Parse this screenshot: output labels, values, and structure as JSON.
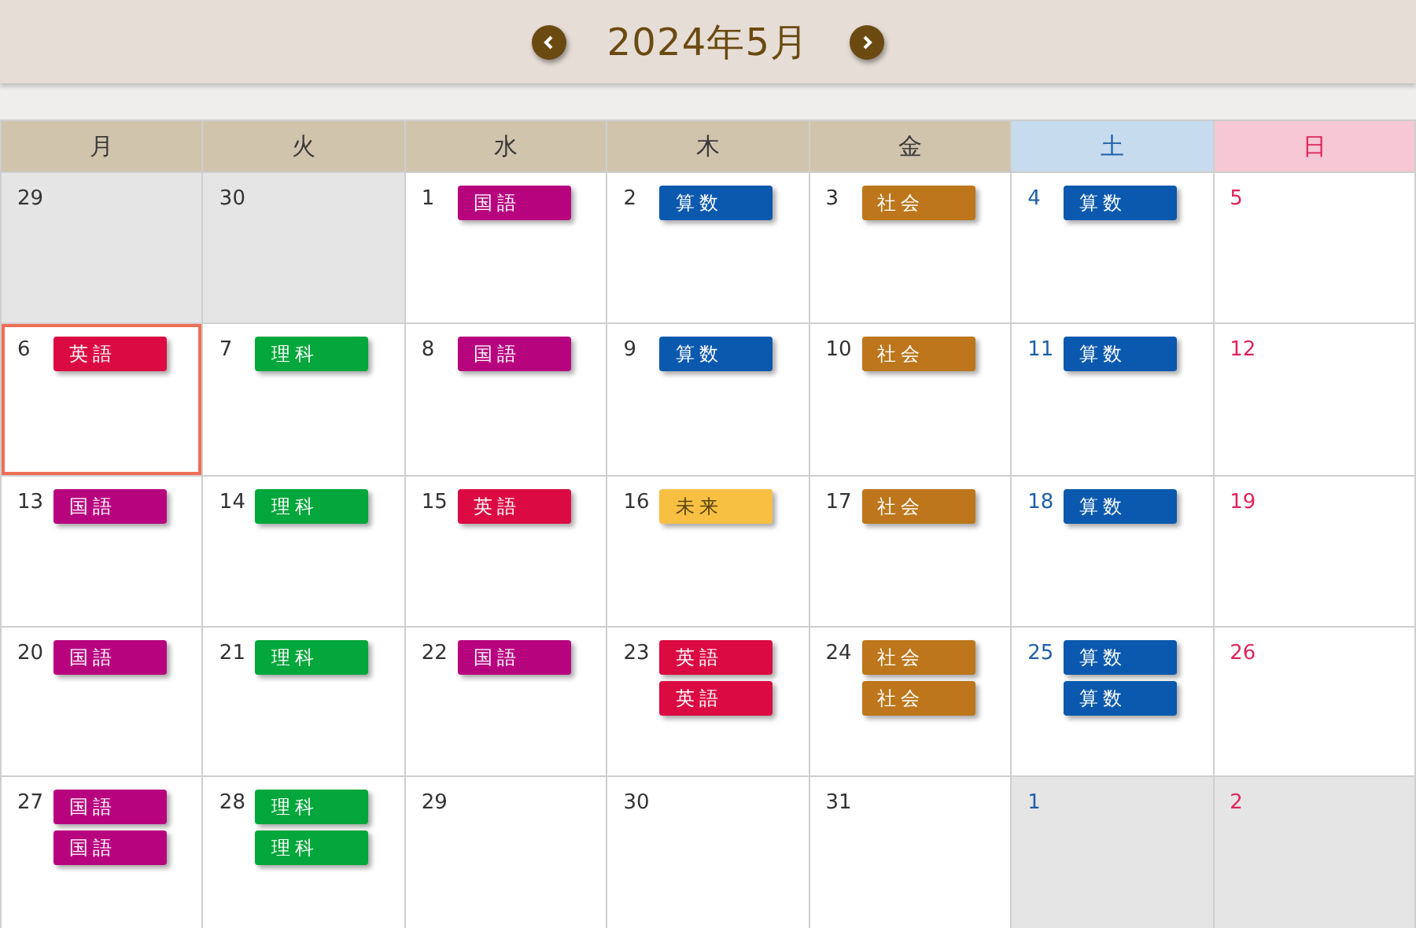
{
  "header": {
    "title": "2024年5月"
  },
  "weekdays": [
    {
      "label": "月",
      "kind": "weekday"
    },
    {
      "label": "火",
      "kind": "weekday"
    },
    {
      "label": "水",
      "kind": "weekday"
    },
    {
      "label": "木",
      "kind": "weekday"
    },
    {
      "label": "金",
      "kind": "weekday"
    },
    {
      "label": "土",
      "kind": "saturday"
    },
    {
      "label": "日",
      "kind": "sunday"
    }
  ],
  "days": [
    {
      "date": "29",
      "outside": true,
      "selected": false
    },
    {
      "date": "30",
      "outside": true,
      "selected": false
    },
    {
      "date": "1",
      "outside": false,
      "selected": false,
      "events": [
        {
          "label": "国語",
          "color": "#b8037f"
        }
      ]
    },
    {
      "date": "2",
      "outside": false,
      "selected": false,
      "events": [
        {
          "label": "算数",
          "color": "#0b59ae"
        }
      ]
    },
    {
      "date": "3",
      "outside": false,
      "selected": false,
      "events": [
        {
          "label": "社会",
          "color": "#bd761b"
        }
      ]
    },
    {
      "date": "4",
      "outside": false,
      "selected": false,
      "events": [
        {
          "label": "算数",
          "color": "#0b59ae"
        }
      ]
    },
    {
      "date": "5",
      "outside": false,
      "selected": false
    },
    {
      "date": "6",
      "outside": false,
      "selected": true,
      "events": [
        {
          "label": "英語",
          "color": "#dc0a42"
        }
      ]
    },
    {
      "date": "7",
      "outside": false,
      "selected": false,
      "events": [
        {
          "label": "理科",
          "color": "#03a73b"
        }
      ]
    },
    {
      "date": "8",
      "outside": false,
      "selected": false,
      "events": [
        {
          "label": "国語",
          "color": "#b8037f"
        }
      ]
    },
    {
      "date": "9",
      "outside": false,
      "selected": false,
      "events": [
        {
          "label": "算数",
          "color": "#0b59ae"
        }
      ]
    },
    {
      "date": "10",
      "outside": false,
      "selected": false,
      "events": [
        {
          "label": "社会",
          "color": "#bd761b"
        }
      ]
    },
    {
      "date": "11",
      "outside": false,
      "selected": false,
      "events": [
        {
          "label": "算数",
          "color": "#0b59ae"
        }
      ]
    },
    {
      "date": "12",
      "outside": false,
      "selected": false
    },
    {
      "date": "13",
      "outside": false,
      "selected": false,
      "events": [
        {
          "label": "国語",
          "color": "#b8037f"
        }
      ]
    },
    {
      "date": "14",
      "outside": false,
      "selected": false,
      "events": [
        {
          "label": "理科",
          "color": "#03a73b"
        }
      ]
    },
    {
      "date": "15",
      "outside": false,
      "selected": false,
      "events": [
        {
          "label": "英語",
          "color": "#dc0a42"
        }
      ]
    },
    {
      "date": "16",
      "outside": false,
      "selected": false,
      "events": [
        {
          "label": "未来",
          "color": "#f7c043"
        }
      ]
    },
    {
      "date": "17",
      "outside": false,
      "selected": false,
      "events": [
        {
          "label": "社会",
          "color": "#bd761b"
        }
      ]
    },
    {
      "date": "18",
      "outside": false,
      "selected": false,
      "events": [
        {
          "label": "算数",
          "color": "#0b59ae"
        }
      ]
    },
    {
      "date": "19",
      "outside": false,
      "selected": false
    },
    {
      "date": "20",
      "outside": false,
      "selected": false,
      "events": [
        {
          "label": "国語",
          "color": "#b8037f"
        }
      ]
    },
    {
      "date": "21",
      "outside": false,
      "selected": false,
      "events": [
        {
          "label": "理科",
          "color": "#03a73b"
        }
      ]
    },
    {
      "date": "22",
      "outside": false,
      "selected": false,
      "events": [
        {
          "label": "国語",
          "color": "#b8037f"
        }
      ]
    },
    {
      "date": "23",
      "outside": false,
      "selected": false,
      "events": [
        {
          "label": "英語",
          "color": "#dc0a42"
        },
        {
          "label": "英語",
          "color": "#dc0a42"
        }
      ]
    },
    {
      "date": "24",
      "outside": false,
      "selected": false,
      "events": [
        {
          "label": "社会",
          "color": "#bd761b"
        },
        {
          "label": "社会",
          "color": "#bd761b"
        }
      ]
    },
    {
      "date": "25",
      "outside": false,
      "selected": false,
      "events": [
        {
          "label": "算数",
          "color": "#0b59ae"
        },
        {
          "label": "算数",
          "color": "#0b59ae"
        }
      ]
    },
    {
      "date": "26",
      "outside": false,
      "selected": false
    },
    {
      "date": "27",
      "outside": false,
      "selected": false,
      "events": [
        {
          "label": "国語",
          "color": "#b8037f"
        },
        {
          "label": "国語",
          "color": "#b8037f"
        }
      ]
    },
    {
      "date": "28",
      "outside": false,
      "selected": false,
      "events": [
        {
          "label": "理科",
          "color": "#03a73b"
        },
        {
          "label": "理科",
          "color": "#03a73b"
        }
      ]
    },
    {
      "date": "29",
      "outside": false,
      "selected": false
    },
    {
      "date": "30",
      "outside": false,
      "selected": false
    },
    {
      "date": "31",
      "outside": false,
      "selected": false
    },
    {
      "date": "1",
      "outside": true,
      "selected": false
    },
    {
      "date": "2",
      "outside": true,
      "selected": false
    }
  ]
}
